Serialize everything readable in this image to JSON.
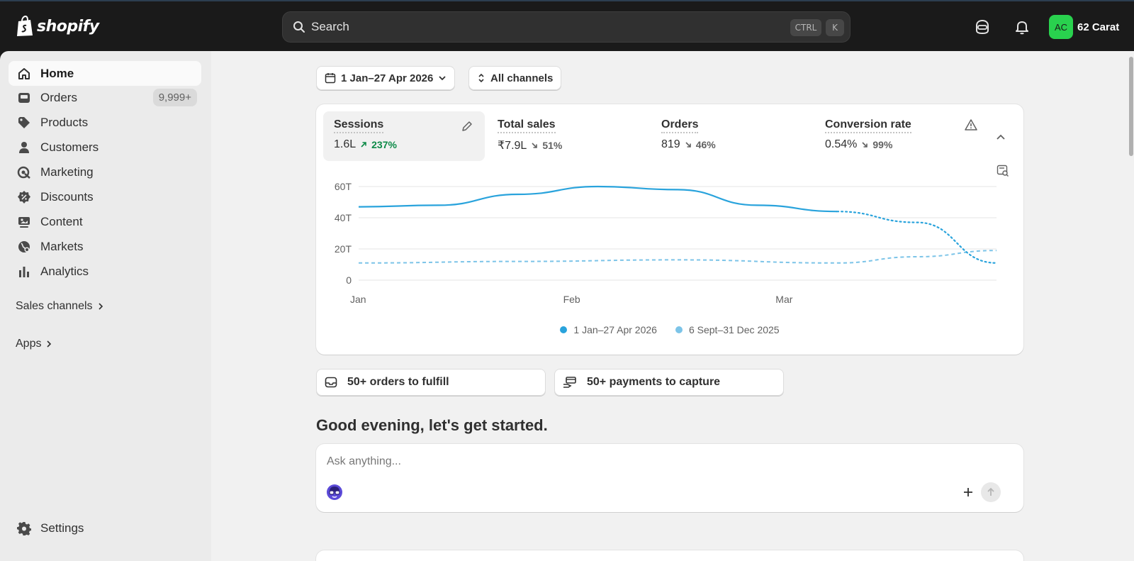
{
  "topbar": {
    "logo_text": "shopify",
    "search_placeholder": "Search",
    "shortcut_ctrl": "CTRL",
    "shortcut_k": "K",
    "avatar_initials": "AC",
    "store_name": "62 Carat"
  },
  "sidebar": {
    "items": [
      {
        "label": "Home",
        "icon": "home-icon",
        "active": true
      },
      {
        "label": "Orders",
        "icon": "orders-icon",
        "badge": "9,999+"
      },
      {
        "label": "Products",
        "icon": "tag-icon"
      },
      {
        "label": "Customers",
        "icon": "person-icon"
      },
      {
        "label": "Marketing",
        "icon": "target-icon"
      },
      {
        "label": "Discounts",
        "icon": "discount-icon"
      },
      {
        "label": "Content",
        "icon": "content-icon"
      },
      {
        "label": "Markets",
        "icon": "globe-icon"
      },
      {
        "label": "Analytics",
        "icon": "bar-chart-icon"
      }
    ],
    "sales_channels": "Sales channels",
    "apps": "Apps",
    "settings": "Settings"
  },
  "filters": {
    "date_range": "1 Jan–27 Apr 2026",
    "channels": "All channels"
  },
  "metrics": [
    {
      "title": "Sessions",
      "value": "1.6L",
      "change": "237%",
      "direction": "up"
    },
    {
      "title": "Total sales",
      "value": "₹7.9L",
      "change": "51%",
      "direction": "down"
    },
    {
      "title": "Orders",
      "value": "819",
      "change": "46%",
      "direction": "down"
    },
    {
      "title": "Conversion rate",
      "value": "0.54%",
      "change": "99%",
      "direction": "down"
    }
  ],
  "chart_data": {
    "type": "line",
    "y_ticks": [
      "60T",
      "40T",
      "20T",
      "0"
    ],
    "x_ticks": [
      "Jan",
      "Feb",
      "Mar"
    ],
    "ylim": [
      0,
      60
    ],
    "grid": true,
    "legend_placement": "bottom",
    "series": [
      {
        "name": "1 Jan–27 Apr 2026",
        "color": "#29a3dc",
        "x": [
          0,
          0.125,
          0.25,
          0.375,
          0.5,
          0.625,
          0.75,
          0.875,
          1
        ],
        "values": [
          47,
          48,
          55,
          60,
          58,
          48,
          44,
          37,
          11
        ]
      },
      {
        "name": "6 Sept–31 Dec 2025",
        "color": "#7cc4e8",
        "x": [
          0,
          0.25,
          0.5,
          0.75,
          0.875,
          1
        ],
        "values": [
          11,
          12,
          13,
          11,
          15,
          19
        ]
      }
    ]
  },
  "tasks": {
    "fulfill": "50+ orders to fulfill",
    "capture": "50+ payments to capture"
  },
  "greeting": "Good evening, let's get started.",
  "ask": {
    "placeholder": "Ask anything..."
  }
}
